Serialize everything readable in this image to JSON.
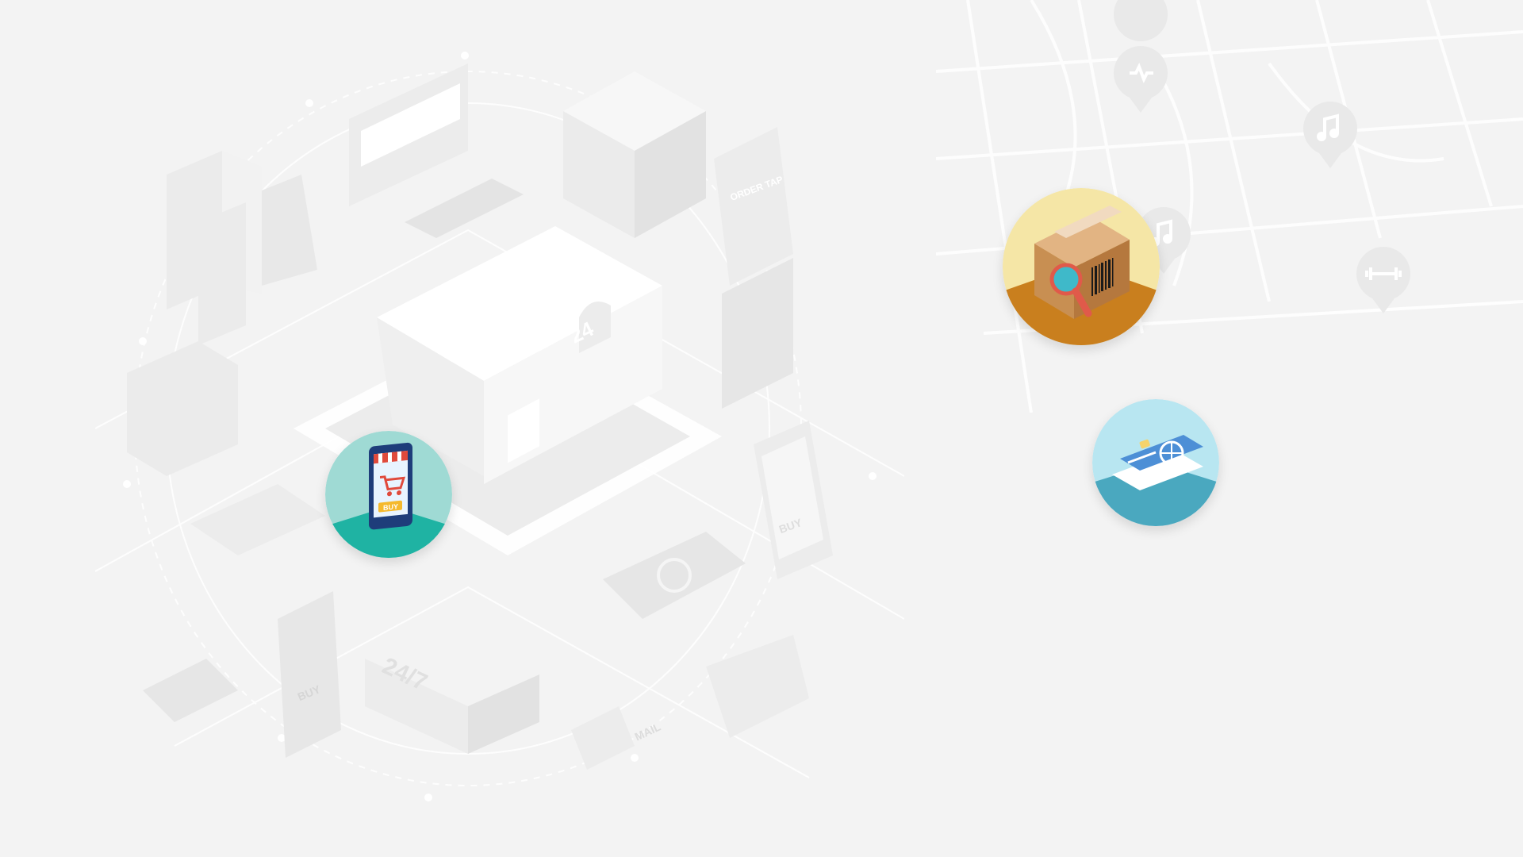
{
  "illustration": {
    "store_sign": "24",
    "truck_label": "24/7",
    "mailbox_label": "MAIL",
    "tablet_label": "BUY",
    "phone_label": "BUY",
    "kiosk_label": "ORDER TAP"
  },
  "badges": [
    {
      "icon": "mobile-shop-icon",
      "label": "BUY",
      "bg_color": "#9fdad4",
      "floor_color": "#1fb3a3"
    },
    {
      "icon": "package-tracking-icon",
      "bg_color": "#f5e6a6",
      "floor_color": "#c97f1e"
    },
    {
      "icon": "credit-card-icon",
      "bg_color": "#b8e6f1",
      "floor_color": "#4aa8bf"
    }
  ],
  "map_pins": [
    "heart-pin-icon",
    "music-pin-icon",
    "music-pin-icon",
    "dumbbell-pin-icon"
  ],
  "colors": {
    "background": "#f3f3f3",
    "line": "#ffffff",
    "faded": "#e6e6e6"
  }
}
